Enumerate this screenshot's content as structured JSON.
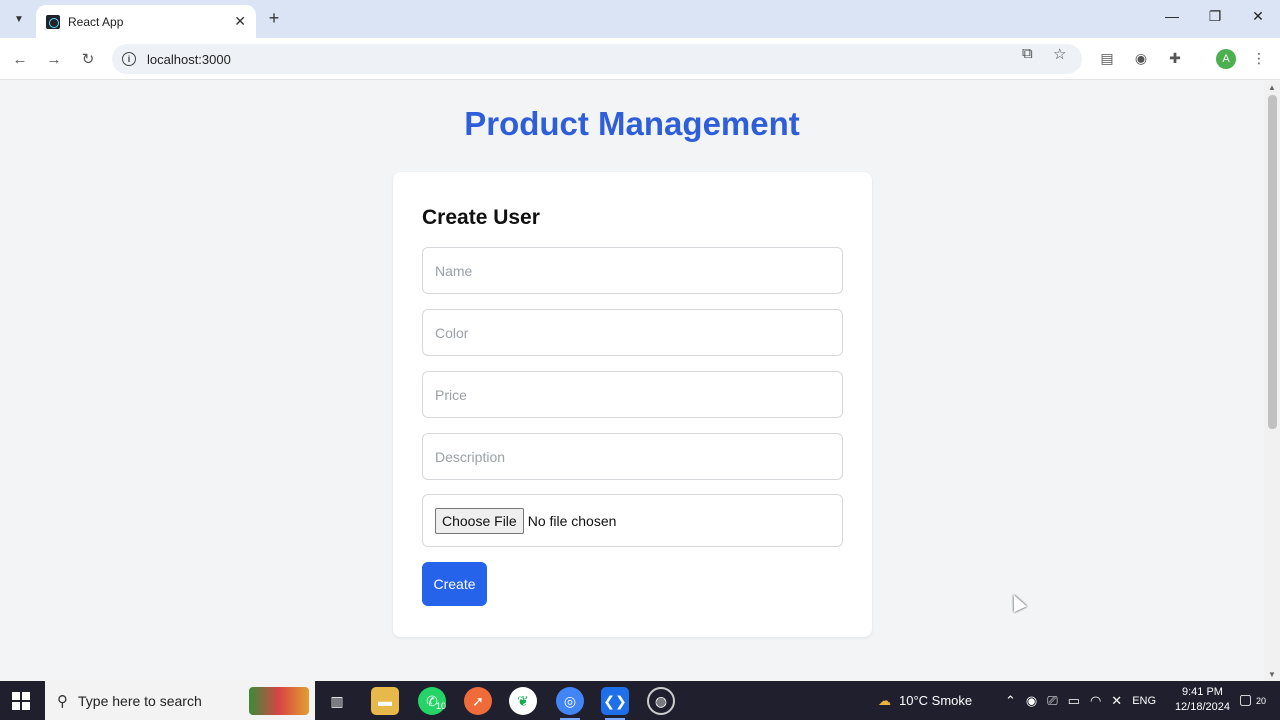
{
  "browser": {
    "tab_title": "React App",
    "tab_close": "✕",
    "new_tab": "+",
    "url": "localhost:3000",
    "profile_initial": "A",
    "window_controls": {
      "minimize": "—",
      "restore": "❐",
      "close": "✕"
    }
  },
  "page": {
    "title": "Product Management",
    "form": {
      "heading": "Create User",
      "name_placeholder": "Name",
      "color_placeholder": "Color",
      "price_placeholder": "Price",
      "description_placeholder": "Description",
      "file_button": "Choose File",
      "file_status": "No file chosen",
      "submit_label": "Create"
    }
  },
  "taskbar": {
    "search_placeholder": "Type here to search",
    "whatsapp_badge": "10",
    "weather": "10°C  Smoke",
    "language": "ENG",
    "time": "9:41 PM",
    "date": "12/18/2024",
    "notifications": "20"
  },
  "colors": {
    "title": "#2f5fd8",
    "button": "#2563eb",
    "page_bg": "#f3f4f6"
  }
}
